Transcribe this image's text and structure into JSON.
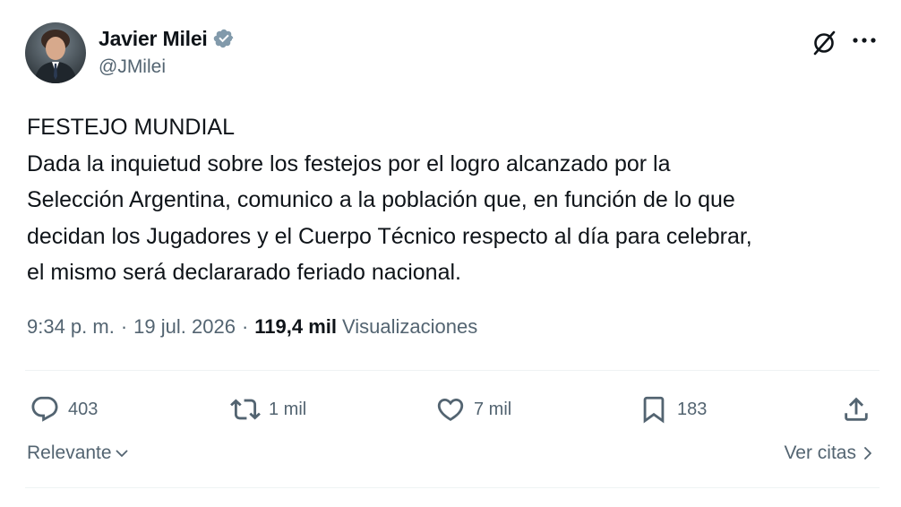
{
  "author": {
    "name": "Javier Milei",
    "handle": "@JMilei",
    "verified": true,
    "avatar_icon": "profile-photo"
  },
  "tweet": {
    "lines": [
      "FESTEJO MUNDIAL",
      "Dada la inquietud sobre los festejos por el logro alcanzado por la",
      "Selección Argentina, comunico a la población que, en función de lo que",
      "decidan los Jugadores y el Cuerpo Técnico respecto al día para celebrar,",
      "el mismo será declararado feriado nacional."
    ]
  },
  "meta": {
    "time": "9:34 p. m.",
    "separator": "·",
    "date": "19 jul. 2026",
    "views_count": "119,4 mil",
    "views_label": "Visualizaciones"
  },
  "actions": {
    "replies": "403",
    "reposts": "1 mil",
    "likes": "7 mil",
    "bookmarks": "183"
  },
  "footer": {
    "sort_label": "Relevante",
    "quotes_label": "Ver citas"
  },
  "colors": {
    "text": "#0f1419",
    "secondary": "#536471",
    "verified": "#829aab",
    "divider": "#eff3f4"
  }
}
